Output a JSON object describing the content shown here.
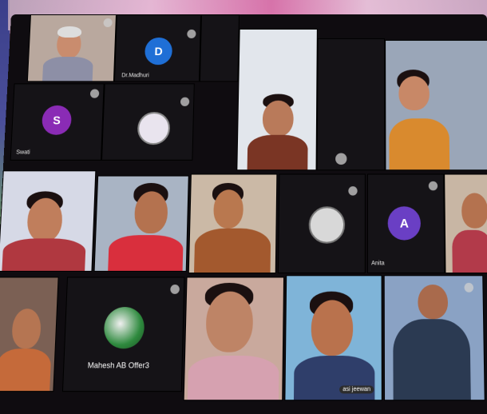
{
  "tiles": {
    "d_tile": {
      "initial": "D",
      "name": "Dr.Madhuri"
    },
    "s_tile": {
      "initial": "S",
      "name": "Swati"
    },
    "a_tile": {
      "initial": "A",
      "name": "Anita"
    },
    "mahesh_tile": {
      "name": "Mahesh AB Offer3"
    },
    "speaker_tile": {
      "badge": "asi jeewan"
    }
  },
  "colors": {
    "avatar_d": "#1f6fd6",
    "avatar_s": "#8a2bb5",
    "avatar_a": "#6a3fc4"
  }
}
